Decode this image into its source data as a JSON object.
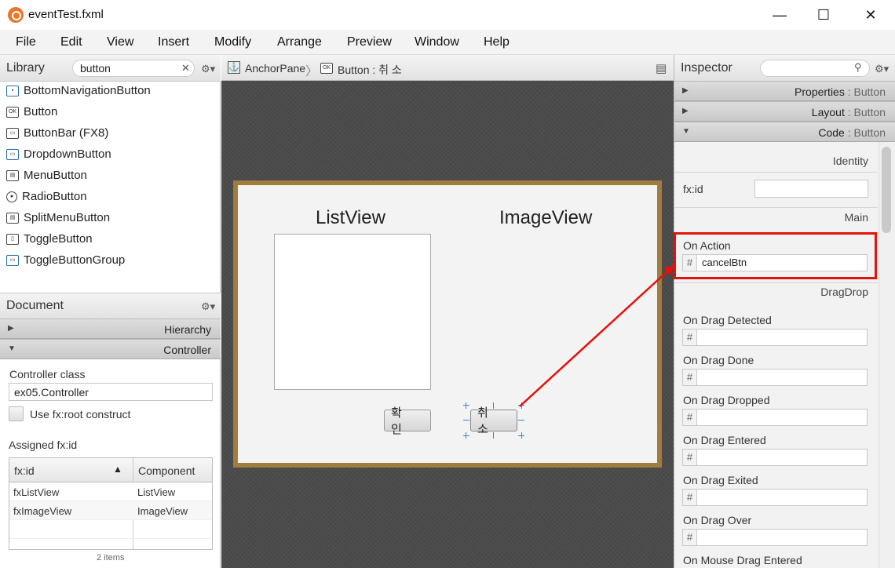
{
  "window": {
    "title": "eventTest.fxml",
    "minimize": "—",
    "maximize": "☐",
    "close": "✕"
  },
  "menu": [
    "File",
    "Edit",
    "View",
    "Insert",
    "Modify",
    "Arrange",
    "Preview",
    "Window",
    "Help"
  ],
  "library": {
    "title": "Library",
    "search_value": "button",
    "clear": "✕",
    "gear": "⚙▾",
    "items": [
      "BottomNavigationButton",
      "Button",
      "ButtonBar  (FX8)",
      "DropdownButton",
      "MenuButton",
      "RadioButton",
      "SplitMenuButton",
      "ToggleButton",
      "ToggleButtonGroup"
    ],
    "item_icons": [
      "▪",
      "OK",
      "▭",
      "▭",
      "▤",
      "●",
      "▤",
      "▯",
      "▭"
    ]
  },
  "document": {
    "title": "Document",
    "gear": "⚙▾",
    "hierarchy_label": "Hierarchy",
    "controller_label": "Controller",
    "controller_class_label": "Controller class",
    "controller_class_value": "ex05.Controller",
    "use_root_label": "Use fx:root construct",
    "assigned_label": "Assigned fx:id",
    "table": {
      "headers": [
        "fx:id",
        "Component"
      ],
      "sort_indicator": "▲",
      "rows": [
        [
          "fxListView",
          "ListView"
        ],
        [
          "fxImageView",
          "ImageView"
        ]
      ],
      "footer": "2 items"
    }
  },
  "breadcrumb": {
    "root": "AnchorPane",
    "root_icon": "⚓",
    "sep": "〉",
    "leaf_icon": "OK",
    "leaf": "Button : 취 소",
    "doc_icon": "▤"
  },
  "canvas": {
    "listview_label": "ListView",
    "imageview_label": "ImageView",
    "ok_button": "확 인",
    "cancel_button": "취 소",
    "border_color": "#a07c3e"
  },
  "inspector": {
    "title": "Inspector",
    "search_icon": "⚲",
    "gear": "⚙▾",
    "sections": [
      {
        "label": "Properties",
        "sub": "Button",
        "arrow": "▶"
      },
      {
        "label": "Layout",
        "sub": "Button",
        "arrow": "▶"
      },
      {
        "label": "Code",
        "sub": "Button",
        "arrow": "▼"
      }
    ],
    "identity_label": "Identity",
    "fxid_label": "fx:id",
    "fxid_value": "",
    "main_label": "Main",
    "on_action_label": "On Action",
    "on_action_value": "cancelBtn",
    "dragdrop_label": "DragDrop",
    "hash": "#",
    "drag_events": [
      "On Drag Detected",
      "On Drag Done",
      "On Drag Dropped",
      "On Drag Entered",
      "On Drag Exited",
      "On Drag Over",
      "On Mouse Drag Entered"
    ]
  },
  "highlight_color": "#e3120b"
}
